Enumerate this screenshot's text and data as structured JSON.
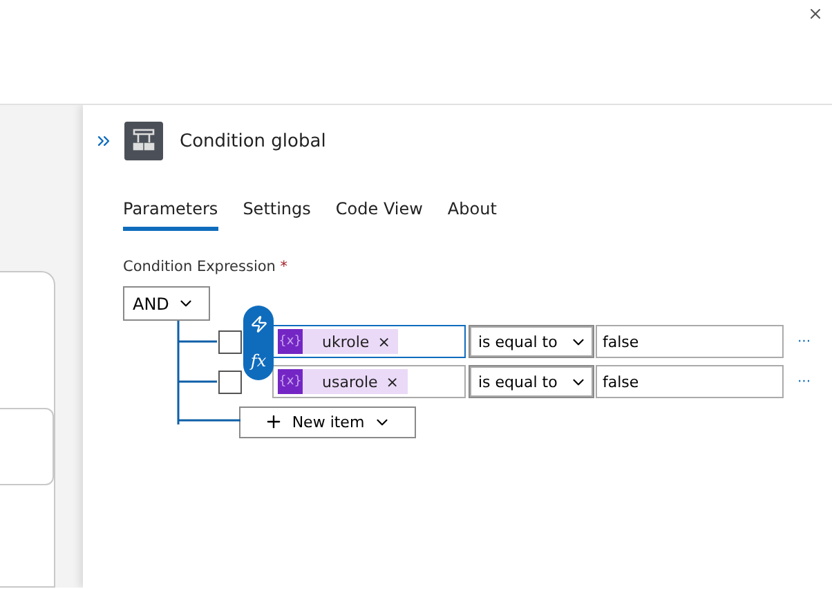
{
  "panel": {
    "title": "Condition global"
  },
  "tabs": [
    {
      "label": "Parameters",
      "selected": true
    },
    {
      "label": "Settings",
      "selected": false
    },
    {
      "label": "Code View",
      "selected": false
    },
    {
      "label": "About",
      "selected": false
    }
  ],
  "expression": {
    "label": "Condition Expression",
    "required_mark": "*",
    "group_operator": "AND",
    "function_button": "fx",
    "rows": [
      {
        "checked": false,
        "focused": true,
        "token_badge": "{x}",
        "token": "ukrole",
        "remove": "×",
        "operator": "is equal to",
        "value": "false",
        "more": "···"
      },
      {
        "checked": false,
        "focused": false,
        "token_badge": "{x}",
        "token": "usarole",
        "remove": "×",
        "operator": "is equal to",
        "value": "false",
        "more": "···"
      }
    ],
    "new_item": "New item"
  }
}
